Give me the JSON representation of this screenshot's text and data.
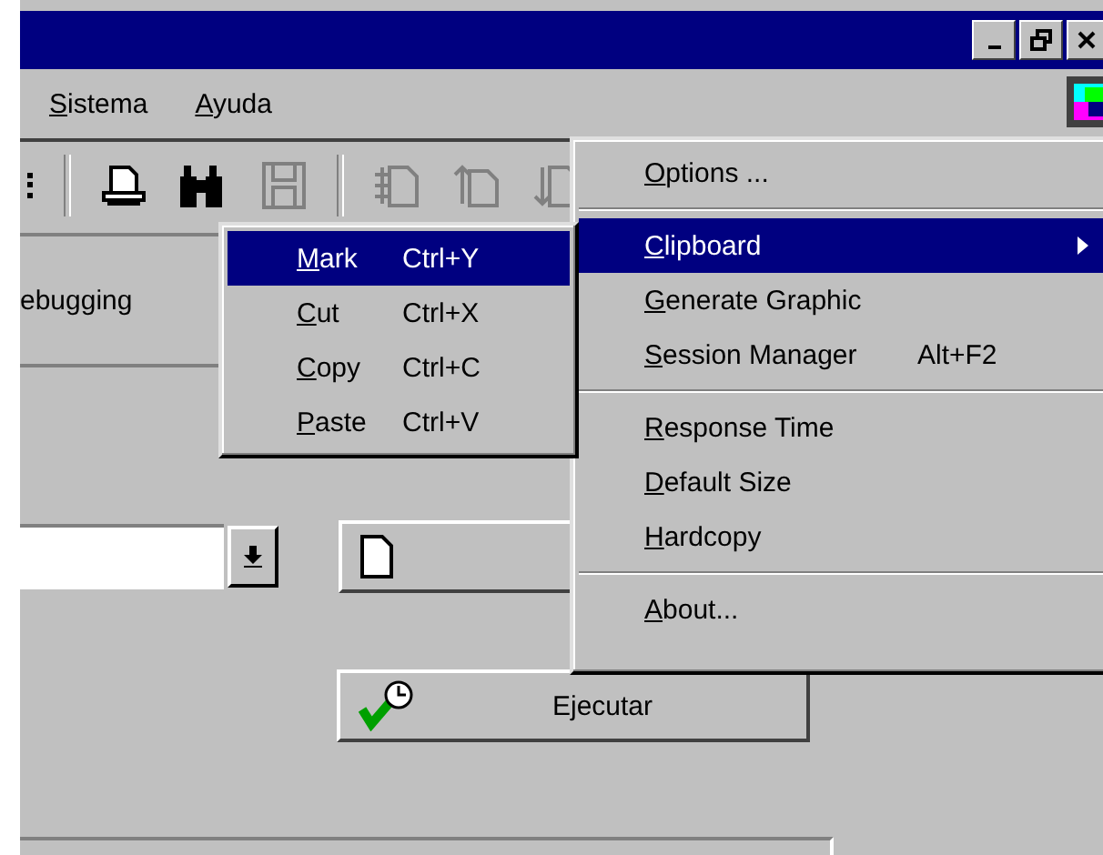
{
  "menu_bar": [
    {
      "label": "Sistema"
    },
    {
      "label": "Ayuda"
    }
  ],
  "toolbar": [
    {
      "kind": "print",
      "disabled": false
    },
    {
      "kind": "find",
      "disabled": false
    },
    {
      "kind": "save",
      "disabled": true
    },
    {
      "kind": "separator"
    },
    {
      "kind": "page-in",
      "disabled": true
    },
    {
      "kind": "page-up",
      "disabled": true
    },
    {
      "kind": "page-down",
      "disabled": true
    }
  ],
  "tab": {
    "label": "ebugging"
  },
  "run_button": {
    "label": "Ejecutar"
  },
  "menu": [
    {
      "kind": "item",
      "label": "Options ...",
      "selected": false
    },
    {
      "kind": "separator"
    },
    {
      "kind": "submenu",
      "label": "Clipboard",
      "selected": true
    },
    {
      "kind": "item",
      "label": "Generate Graphic",
      "selected": false
    },
    {
      "kind": "item",
      "label": "Session Manager",
      "shortcut": "Alt+F2",
      "selected": false
    },
    {
      "kind": "separator"
    },
    {
      "kind": "item",
      "label": "Response Time",
      "selected": false
    },
    {
      "kind": "item",
      "label": "Default Size",
      "selected": false
    },
    {
      "kind": "item",
      "label": "Hardcopy",
      "selected": false
    },
    {
      "kind": "separator"
    },
    {
      "kind": "item",
      "label": "About...",
      "selected": false
    }
  ],
  "submenu": [
    {
      "label": "Mark",
      "shortcut": "Ctrl+Y",
      "selected": true
    },
    {
      "label": "Cut",
      "shortcut": "Ctrl+X",
      "selected": false
    },
    {
      "label": "Copy",
      "shortcut": "Ctrl+C",
      "selected": false
    },
    {
      "label": "Paste",
      "shortcut": "Ctrl+V",
      "selected": false
    }
  ]
}
